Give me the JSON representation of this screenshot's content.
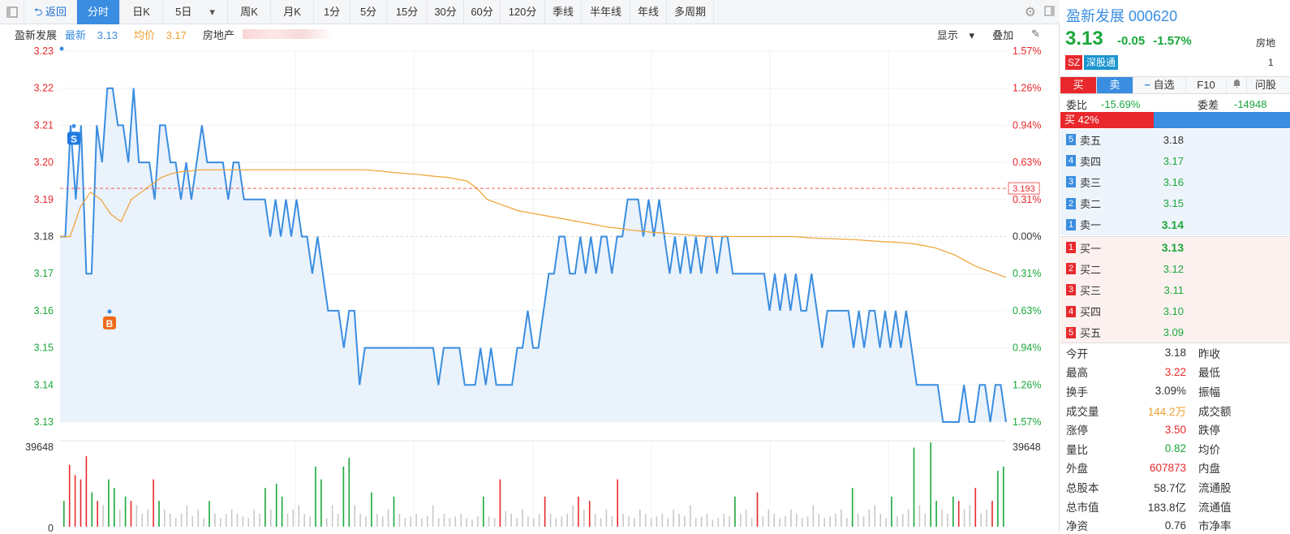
{
  "toolbar": {
    "back_label": "返回",
    "periods": [
      {
        "label": "分时",
        "active": true
      },
      {
        "label": "日K",
        "active": false
      },
      {
        "label": "5日",
        "active": false,
        "dropdown": true
      },
      {
        "label": "周K",
        "active": false
      },
      {
        "label": "月K",
        "active": false
      },
      {
        "label": "1分",
        "active": false
      },
      {
        "label": "5分",
        "active": false
      },
      {
        "label": "15分",
        "active": false
      },
      {
        "label": "30分",
        "active": false
      },
      {
        "label": "60分",
        "active": false
      },
      {
        "label": "120分",
        "active": false
      },
      {
        "label": "季线",
        "active": false
      },
      {
        "label": "半年线",
        "active": false
      },
      {
        "label": "年线",
        "active": false
      },
      {
        "label": "多周期",
        "active": false
      }
    ]
  },
  "info": {
    "name": "盈新发展",
    "latest_label": "最新",
    "latest_value": "3.13",
    "avg_label": "均价",
    "avg_value": "3.17",
    "sector": "房地产",
    "display_label": "显示",
    "overlay_label": "叠加"
  },
  "chart_data": {
    "type": "line",
    "title": "",
    "series": [
      {
        "name": "最新",
        "color": "#3a8de0",
        "values": [
          3.18,
          3.18,
          3.21,
          3.19,
          3.21,
          3.17,
          3.17,
          3.21,
          3.2,
          3.22,
          3.22,
          3.21,
          3.21,
          3.2,
          3.22,
          3.2,
          3.2,
          3.2,
          3.19,
          3.21,
          3.21,
          3.2,
          3.2,
          3.19,
          3.2,
          3.19,
          3.2,
          3.21,
          3.2,
          3.2,
          3.2,
          3.2,
          3.19,
          3.2,
          3.2,
          3.19,
          3.19,
          3.19,
          3.19,
          3.19,
          3.18,
          3.19,
          3.18,
          3.19,
          3.18,
          3.19,
          3.18,
          3.18,
          3.17,
          3.18,
          3.17,
          3.16,
          3.16,
          3.16,
          3.15,
          3.16,
          3.16,
          3.14,
          3.15,
          3.15,
          3.15,
          3.15,
          3.15,
          3.15,
          3.15,
          3.15,
          3.15,
          3.15,
          3.15,
          3.15,
          3.15,
          3.15,
          3.14,
          3.15,
          3.15,
          3.15,
          3.15,
          3.14,
          3.14,
          3.14,
          3.15,
          3.14,
          3.15,
          3.14,
          3.14,
          3.14,
          3.14,
          3.15,
          3.15,
          3.16,
          3.15,
          3.15,
          3.16,
          3.17,
          3.17,
          3.18,
          3.18,
          3.17,
          3.17,
          3.18,
          3.17,
          3.18,
          3.17,
          3.18,
          3.18,
          3.17,
          3.18,
          3.18,
          3.19,
          3.19,
          3.19,
          3.18,
          3.19,
          3.18,
          3.19,
          3.18,
          3.17,
          3.18,
          3.17,
          3.18,
          3.17,
          3.18,
          3.17,
          3.18,
          3.18,
          3.17,
          3.18,
          3.18,
          3.17,
          3.17,
          3.17,
          3.17,
          3.17,
          3.17,
          3.17,
          3.16,
          3.17,
          3.16,
          3.17,
          3.16,
          3.17,
          3.16,
          3.16,
          3.17,
          3.16,
          3.15,
          3.16,
          3.16,
          3.16,
          3.16,
          3.16,
          3.15,
          3.16,
          3.15,
          3.16,
          3.16,
          3.15,
          3.16,
          3.15,
          3.16,
          3.15,
          3.16,
          3.15,
          3.14,
          3.14,
          3.14,
          3.14,
          3.14,
          3.13,
          3.13,
          3.13,
          3.13,
          3.14,
          3.13,
          3.13,
          3.14,
          3.14,
          3.13,
          3.14,
          3.14,
          3.13
        ]
      },
      {
        "name": "均价",
        "color": "#f0a030",
        "values": [
          3.18,
          3.18,
          3.188,
          3.192,
          3.19,
          3.186,
          3.184,
          3.19,
          3.192,
          3.194,
          3.196,
          3.197,
          3.1975,
          3.1978,
          3.198,
          3.198,
          3.198,
          3.198,
          3.198,
          3.198,
          3.198,
          3.198,
          3.198,
          3.198,
          3.198,
          3.198,
          3.198,
          3.198,
          3.198,
          3.198,
          3.198,
          3.1978,
          3.1975,
          3.1972,
          3.197,
          3.1968,
          3.1965,
          3.1962,
          3.196,
          3.1955,
          3.195,
          3.193,
          3.19,
          3.189,
          3.188,
          3.187,
          3.1865,
          3.186,
          3.1855,
          3.185,
          3.1845,
          3.184,
          3.1835,
          3.183,
          3.1825,
          3.1822,
          3.1818,
          3.1815,
          3.1812,
          3.181,
          3.1808,
          3.1806,
          3.1804,
          3.1802,
          3.18,
          3.18,
          3.18,
          3.18,
          3.18,
          3.18,
          3.18,
          3.18,
          3.18,
          3.1798,
          3.1796,
          3.1795,
          3.1794,
          3.1793,
          3.1792,
          3.179,
          3.1788,
          3.1786,
          3.1785,
          3.1783,
          3.178,
          3.1775,
          3.177,
          3.176,
          3.175,
          3.1735,
          3.172,
          3.171,
          3.17,
          3.169
        ]
      }
    ],
    "prev_close": 3.18,
    "reference_line": "3.193",
    "ylim": [
      3.13,
      3.23
    ],
    "y_ticks_left": [
      "3.23",
      "3.22",
      "3.21",
      "3.20",
      "3.19",
      "3.18",
      "3.17",
      "3.16",
      "3.15",
      "3.14",
      "3.13"
    ],
    "y_ticks_right": [
      "1.57%",
      "1.26%",
      "0.94%",
      "0.63%",
      "0.31%",
      "0.00%",
      "0.31%",
      "0.63%",
      "0.94%",
      "1.26%",
      "1.57%"
    ],
    "markers": [
      {
        "label": "S",
        "color": "#1f7ae0"
      },
      {
        "label": "B",
        "color": "#f06a1a"
      }
    ],
    "volume_max_label": "39648",
    "volume_zero_label": "0"
  },
  "volume": {
    "max": 39648,
    "bars": [
      [
        0.3,
        "g"
      ],
      [
        0.72,
        "r"
      ],
      [
        0.6,
        "r"
      ],
      [
        0.55,
        "r"
      ],
      [
        0.82,
        "r"
      ],
      [
        0.4,
        "g"
      ],
      [
        0.3,
        "r"
      ],
      [
        0.25,
        "g"
      ],
      [
        0.55,
        "g"
      ],
      [
        0.45,
        "g"
      ],
      [
        0.2,
        "r"
      ],
      [
        0.35,
        "g"
      ],
      [
        0.3,
        "r"
      ],
      [
        0.25,
        "g"
      ],
      [
        0.15,
        "r"
      ],
      [
        0.2,
        "g"
      ],
      [
        0.55,
        "r"
      ],
      [
        0.3,
        "g"
      ],
      [
        0.2,
        "r"
      ],
      [
        0.15,
        "g"
      ],
      [
        0.1,
        "r"
      ],
      [
        0.15,
        "g"
      ],
      [
        0.25,
        "g"
      ],
      [
        0.12,
        "r"
      ],
      [
        0.2,
        "g"
      ],
      [
        0.1,
        "g"
      ],
      [
        0.3,
        "g"
      ],
      [
        0.15,
        "r"
      ],
      [
        0.1,
        "g"
      ],
      [
        0.15,
        "r"
      ],
      [
        0.2,
        "g"
      ],
      [
        0.15,
        "g"
      ],
      [
        0.12,
        "r"
      ],
      [
        0.1,
        "r"
      ],
      [
        0.2,
        "g"
      ],
      [
        0.15,
        "g"
      ],
      [
        0.45,
        "g"
      ],
      [
        0.2,
        "g"
      ],
      [
        0.5,
        "g"
      ],
      [
        0.35,
        "g"
      ],
      [
        0.15,
        "g"
      ],
      [
        0.2,
        "g"
      ],
      [
        0.25,
        "g"
      ],
      [
        0.15,
        "g"
      ],
      [
        0.12,
        "r"
      ],
      [
        0.7,
        "g"
      ],
      [
        0.55,
        "g"
      ],
      [
        0.1,
        "g"
      ],
      [
        0.25,
        "g"
      ],
      [
        0.15,
        "g"
      ],
      [
        0.7,
        "g"
      ],
      [
        0.8,
        "g"
      ],
      [
        0.25,
        "g"
      ],
      [
        0.15,
        "g"
      ],
      [
        0.12,
        "g"
      ],
      [
        0.4,
        "g"
      ],
      [
        0.15,
        "g"
      ],
      [
        0.12,
        "g"
      ],
      [
        0.2,
        "g"
      ],
      [
        0.35,
        "g"
      ],
      [
        0.15,
        "g"
      ],
      [
        0.1,
        "g"
      ],
      [
        0.12,
        "g"
      ],
      [
        0.15,
        "g"
      ],
      [
        0.1,
        "g"
      ],
      [
        0.12,
        "g"
      ],
      [
        0.25,
        "g"
      ],
      [
        0.1,
        "g"
      ],
      [
        0.15,
        "g"
      ],
      [
        0.1,
        "g"
      ],
      [
        0.12,
        "g"
      ],
      [
        0.15,
        "g"
      ],
      [
        0.1,
        "g"
      ],
      [
        0.08,
        "g"
      ],
      [
        0.12,
        "g"
      ],
      [
        0.35,
        "g"
      ],
      [
        0.12,
        "g"
      ],
      [
        0.1,
        "g"
      ],
      [
        0.55,
        "r"
      ],
      [
        0.18,
        "r"
      ],
      [
        0.15,
        "g"
      ],
      [
        0.1,
        "r"
      ],
      [
        0.2,
        "r"
      ],
      [
        0.12,
        "r"
      ],
      [
        0.1,
        "g"
      ],
      [
        0.15,
        "g"
      ],
      [
        0.35,
        "r"
      ],
      [
        0.15,
        "g"
      ],
      [
        0.1,
        "g"
      ],
      [
        0.12,
        "r"
      ],
      [
        0.15,
        "g"
      ],
      [
        0.25,
        "g"
      ],
      [
        0.35,
        "r"
      ],
      [
        0.2,
        "g"
      ],
      [
        0.3,
        "r"
      ],
      [
        0.15,
        "g"
      ],
      [
        0.1,
        "r"
      ],
      [
        0.2,
        "r"
      ],
      [
        0.12,
        "g"
      ],
      [
        0.55,
        "r"
      ],
      [
        0.15,
        "g"
      ],
      [
        0.12,
        "r"
      ],
      [
        0.1,
        "g"
      ],
      [
        0.2,
        "r"
      ],
      [
        0.15,
        "g"
      ],
      [
        0.1,
        "r"
      ],
      [
        0.12,
        "r"
      ],
      [
        0.15,
        "r"
      ],
      [
        0.1,
        "g"
      ],
      [
        0.2,
        "r"
      ],
      [
        0.15,
        "g"
      ],
      [
        0.12,
        "r"
      ],
      [
        0.25,
        "r"
      ],
      [
        0.1,
        "g"
      ],
      [
        0.12,
        "g"
      ],
      [
        0.15,
        "r"
      ],
      [
        0.08,
        "g"
      ],
      [
        0.1,
        "r"
      ],
      [
        0.15,
        "r"
      ],
      [
        0.12,
        "g"
      ],
      [
        0.35,
        "g"
      ],
      [
        0.15,
        "g"
      ],
      [
        0.2,
        "g"
      ],
      [
        0.1,
        "g"
      ],
      [
        0.4,
        "r"
      ],
      [
        0.12,
        "g"
      ],
      [
        0.2,
        "g"
      ],
      [
        0.15,
        "r"
      ],
      [
        0.1,
        "g"
      ],
      [
        0.12,
        "g"
      ],
      [
        0.2,
        "g"
      ],
      [
        0.15,
        "g"
      ],
      [
        0.1,
        "g"
      ],
      [
        0.12,
        "g"
      ],
      [
        0.25,
        "g"
      ],
      [
        0.15,
        "g"
      ],
      [
        0.1,
        "g"
      ],
      [
        0.12,
        "g"
      ],
      [
        0.15,
        "g"
      ],
      [
        0.2,
        "g"
      ],
      [
        0.1,
        "g"
      ],
      [
        0.45,
        "g"
      ],
      [
        0.15,
        "g"
      ],
      [
        0.12,
        "g"
      ],
      [
        0.2,
        "g"
      ],
      [
        0.25,
        "g"
      ],
      [
        0.15,
        "g"
      ],
      [
        0.1,
        "g"
      ],
      [
        0.35,
        "g"
      ],
      [
        0.12,
        "g"
      ],
      [
        0.15,
        "g"
      ],
      [
        0.2,
        "g"
      ],
      [
        0.92,
        "g"
      ],
      [
        0.25,
        "g"
      ],
      [
        0.15,
        "g"
      ],
      [
        0.98,
        "g"
      ],
      [
        0.3,
        "g"
      ],
      [
        0.2,
        "g"
      ],
      [
        0.15,
        "g"
      ],
      [
        0.35,
        "g"
      ],
      [
        0.3,
        "r"
      ],
      [
        0.2,
        "g"
      ],
      [
        0.25,
        "r"
      ],
      [
        0.45,
        "r"
      ],
      [
        0.15,
        "g"
      ],
      [
        0.2,
        "g"
      ],
      [
        0.3,
        "r"
      ],
      [
        0.65,
        "g"
      ],
      [
        0.7,
        "g"
      ]
    ]
  },
  "stock": {
    "name": "盈新发展",
    "code": "000620",
    "price": "3.13",
    "change": "-0.05",
    "change_pct": "-1.57%",
    "side_label": "房地",
    "side_value": "1",
    "tag_sz": "SZ",
    "tag_connect": "深股通"
  },
  "trade_tabs": {
    "buy": "买",
    "sell": "卖",
    "watch": "自选",
    "f10": "F10",
    "ask": "问股"
  },
  "weibi": {
    "label": "委比",
    "value": "-15.69%",
    "diff_label": "委差",
    "diff_value": "-14948"
  },
  "buy_ratio": {
    "label": "买 42%",
    "pct": 42
  },
  "asks": [
    {
      "num": "5",
      "label": "卖五",
      "price": "3.18",
      "color": "#333"
    },
    {
      "num": "4",
      "label": "卖四",
      "price": "3.17",
      "color": "#1aa83b"
    },
    {
      "num": "3",
      "label": "卖三",
      "price": "3.16",
      "color": "#1aa83b"
    },
    {
      "num": "2",
      "label": "卖二",
      "price": "3.15",
      "color": "#1aa83b"
    },
    {
      "num": "1",
      "label": "卖一",
      "price": "3.14",
      "color": "#1aa83b"
    }
  ],
  "bids": [
    {
      "num": "1",
      "label": "买一",
      "price": "3.13",
      "color": "#1aa83b"
    },
    {
      "num": "2",
      "label": "买二",
      "price": "3.12",
      "color": "#1aa83b"
    },
    {
      "num": "3",
      "label": "买三",
      "price": "3.11",
      "color": "#1aa83b"
    },
    {
      "num": "4",
      "label": "买四",
      "price": "3.10",
      "color": "#1aa83b"
    },
    {
      "num": "5",
      "label": "买五",
      "price": "3.09",
      "color": "#1aa83b"
    }
  ],
  "stats": [
    {
      "l": "今开",
      "v": "3.18",
      "c": "#333",
      "l2": "昨收"
    },
    {
      "l": "最高",
      "v": "3.22",
      "c": "#e8282c",
      "l2": "最低"
    },
    {
      "l": "换手",
      "v": "3.09%",
      "c": "#333",
      "l2": "振幅"
    },
    {
      "l": "成交量",
      "v": "144.2万",
      "c": "#f0a030",
      "l2": "成交额"
    },
    {
      "l": "涨停",
      "v": "3.50",
      "c": "#e8282c",
      "l2": "跌停"
    },
    {
      "l": "量比",
      "v": "0.82",
      "c": "#1aa83b",
      "l2": "均价"
    },
    {
      "l": "外盘",
      "v": "607873",
      "c": "#e8282c",
      "l2": "内盘"
    },
    {
      "l": "总股本",
      "v": "58.7亿",
      "c": "#333",
      "l2": "流通股"
    },
    {
      "l": "总市值",
      "v": "183.8亿",
      "c": "#333",
      "l2": "流通值"
    },
    {
      "l": "净资",
      "v": "0.76",
      "c": "#333",
      "l2": "市净率"
    }
  ]
}
